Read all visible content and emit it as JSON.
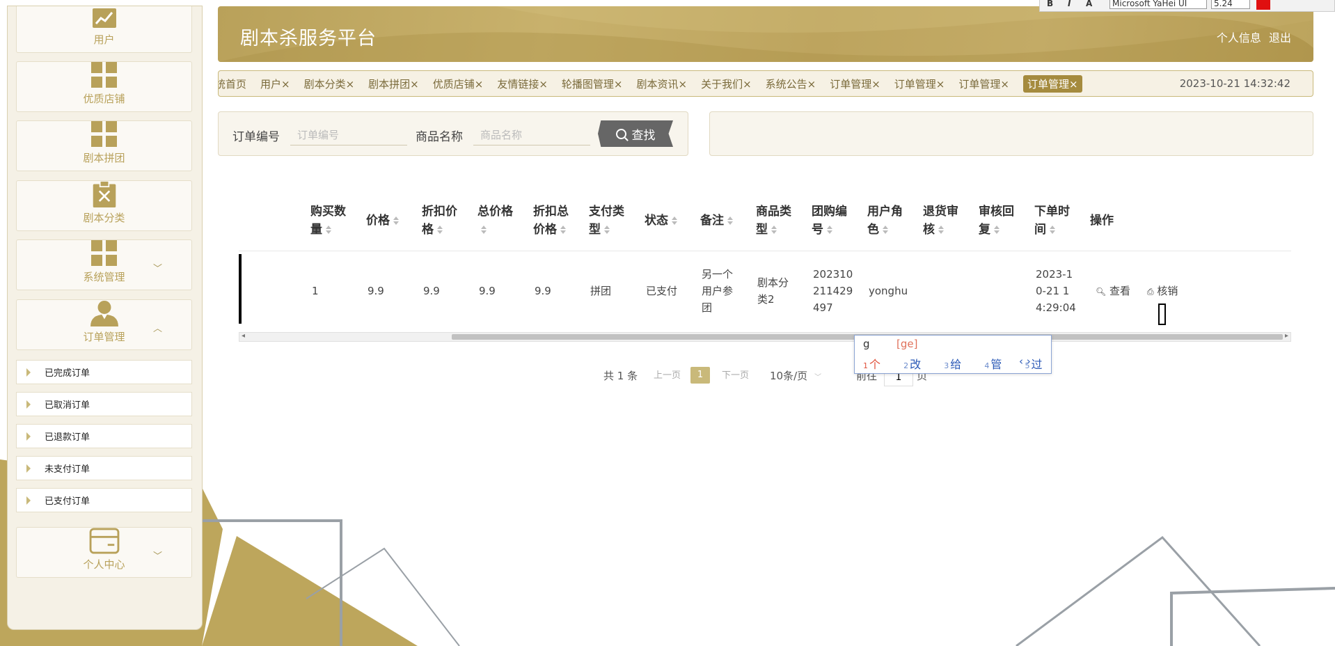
{
  "header": {
    "title": "剧本杀服务平台",
    "profile_link": "个人信息",
    "logout_link": "退出"
  },
  "sidebar": {
    "menu": [
      {
        "label": "用户",
        "icon": "chart-icon"
      },
      {
        "label": "优质店铺",
        "icon": "grid-icon"
      },
      {
        "label": "剧本拼团",
        "icon": "grid-icon"
      },
      {
        "label": "剧本分类",
        "icon": "clipboard-x-icon"
      },
      {
        "label": "系统管理",
        "icon": "grid-icon",
        "expandable": true
      },
      {
        "label": "订单管理",
        "icon": "user-icon",
        "expanded": true
      }
    ],
    "order_sub_items": [
      "已完成订单",
      "已取消订单",
      "已退款订单",
      "未支付订单",
      "已支付订单"
    ],
    "personal_center": {
      "label": "个人中心",
      "icon": "card-icon"
    }
  },
  "tabs": {
    "items": [
      {
        "label": "统首页"
      },
      {
        "label": "用户×"
      },
      {
        "label": "剧本分类×"
      },
      {
        "label": "剧本拼团×"
      },
      {
        "label": "优质店铺×"
      },
      {
        "label": "友情链接×"
      },
      {
        "label": "轮播图管理×"
      },
      {
        "label": "剧本资讯×"
      },
      {
        "label": "关于我们×"
      },
      {
        "label": "系统公告×"
      },
      {
        "label": "订单管理×"
      },
      {
        "label": "订单管理×"
      },
      {
        "label": "订单管理×"
      },
      {
        "label": "订单管理×",
        "active": true
      }
    ],
    "datetime": "2023-10-21 14:32:42"
  },
  "search": {
    "order_no_label": "订单编号",
    "order_no_placeholder": "订单编号",
    "goods_name_label": "商品名称",
    "goods_name_placeholder": "商品名称",
    "search_button": "查找"
  },
  "table": {
    "headers": [
      [
        "购买数",
        "量"
      ],
      [
        "价格",
        ""
      ],
      [
        "折扣价",
        "格"
      ],
      [
        "总价格",
        ""
      ],
      [
        "折扣总",
        "价格"
      ],
      [
        "支付类",
        "型"
      ],
      [
        "状态",
        ""
      ],
      [
        "备注",
        ""
      ],
      [
        "商品类",
        "型"
      ],
      [
        "团购编",
        "号"
      ],
      [
        "用户角",
        "色"
      ],
      [
        "退货审",
        "核"
      ],
      [
        "审核回",
        "复"
      ],
      [
        "下单时",
        "间"
      ],
      [
        "操作",
        ""
      ]
    ],
    "row": {
      "quantity": "1",
      "price": "9.9",
      "discount_price": "9.9",
      "total_price": "9.9",
      "discount_total": "9.9",
      "pay_type": "拼团",
      "status": "已支付",
      "remark": [
        "另一个",
        "用户参",
        "团"
      ],
      "goods_type": [
        "剧本分",
        "类2"
      ],
      "group_no": [
        "202310",
        "211429",
        "497"
      ],
      "user_role": "yonghu",
      "order_time": [
        "2023-1",
        "0-21 1",
        "4:29:04"
      ],
      "op_view": "查看",
      "op_verify": "核销"
    }
  },
  "pagination": {
    "total": "共 1 条",
    "prev": "上一页",
    "current": "1",
    "next": "下一页",
    "page_size": "10条/页",
    "goto": "前往",
    "goto_value": "1",
    "page_unit": "页"
  },
  "ime": {
    "typed": "g",
    "pinyin": "[ge]",
    "candidates": [
      {
        "n": "1",
        "c": "个"
      },
      {
        "n": "2",
        "c": "改"
      },
      {
        "n": "3",
        "c": "给"
      },
      {
        "n": "4",
        "c": "管"
      },
      {
        "n": "5",
        "c": "过"
      }
    ],
    "nav": "‹ ›"
  },
  "toolbar": {
    "font": "Microsoft YaHei UI",
    "size": "5.24"
  },
  "colors": {
    "accent": "#b9a15a",
    "active_tab": "#a58b3e",
    "sidebar_bg": "#f5f1e6"
  }
}
